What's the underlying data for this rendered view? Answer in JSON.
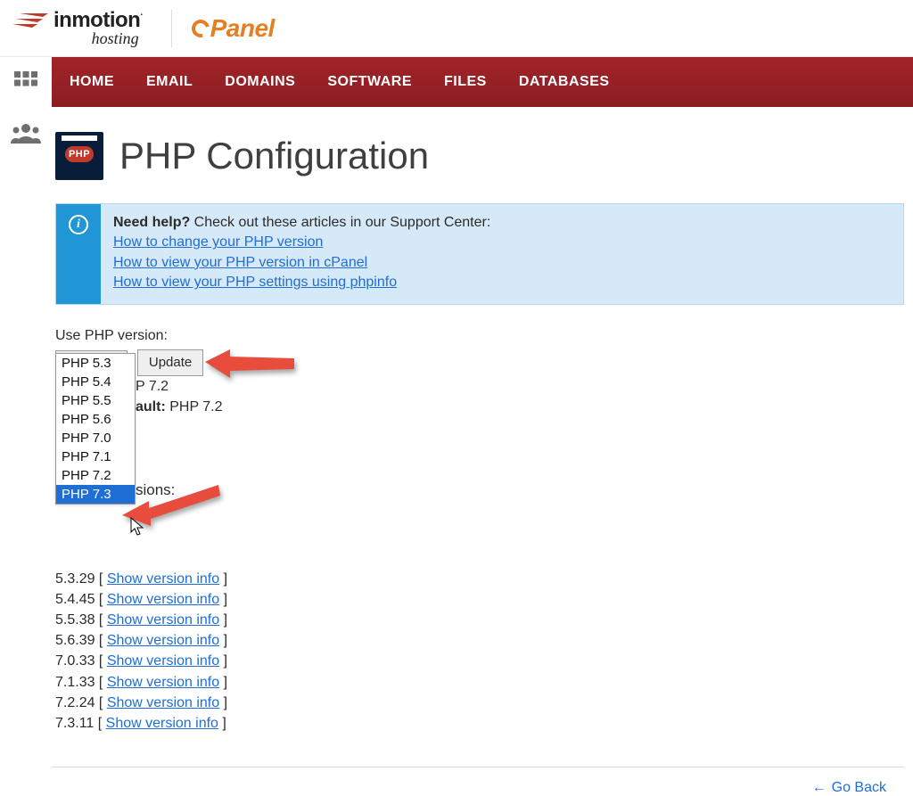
{
  "header": {
    "brand_main": "inmotion",
    "brand_dot": ".",
    "brand_sub": "hosting",
    "cpanel": "Panel"
  },
  "nav": {
    "items": [
      "HOME",
      "EMAIL",
      "DOMAINS",
      "SOFTWARE",
      "FILES",
      "DATABASES"
    ]
  },
  "page": {
    "icon_text": "PHP",
    "title": "PHP Configuration"
  },
  "info": {
    "icon_glyph": "i",
    "title": "Need help?",
    "lead": " Check out these articles in our Support Center:",
    "links": [
      "How to change your PHP version",
      "How to view your PHP version in cPanel",
      "How to view your PHP settings using phpinfo"
    ]
  },
  "form": {
    "label": "Use PHP version:",
    "selected": "PHP 7.2",
    "caret": "▾",
    "update": "Update",
    "options": [
      "PHP 5.3",
      "PHP 5.4",
      "PHP 5.5",
      "PHP 5.6",
      "PHP 7.0",
      "PHP 7.1",
      "PHP 7.2",
      "PHP 7.3"
    ],
    "highlighted_index": 7
  },
  "behind": {
    "line1_frag": "P 7.2",
    "line2_label_frag": "ault:",
    "line2_value": " PHP 7.2",
    "versions_heading_frag": "sions:"
  },
  "versions": {
    "rows": [
      {
        "v": "5.3.29",
        "link": "Show version info"
      },
      {
        "v": "5.4.45",
        "link": "Show version info"
      },
      {
        "v": "5.5.38",
        "link": "Show version info"
      },
      {
        "v": "5.6.39",
        "link": "Show version info"
      },
      {
        "v": "7.0.33",
        "link": "Show version info"
      },
      {
        "v": "7.1.33",
        "link": "Show version info"
      },
      {
        "v": "7.2.24",
        "link": "Show version info"
      },
      {
        "v": "7.3.11",
        "link": "Show version info"
      }
    ]
  },
  "footer": {
    "go_back_arrow": "←",
    "go_back": "Go Back"
  }
}
